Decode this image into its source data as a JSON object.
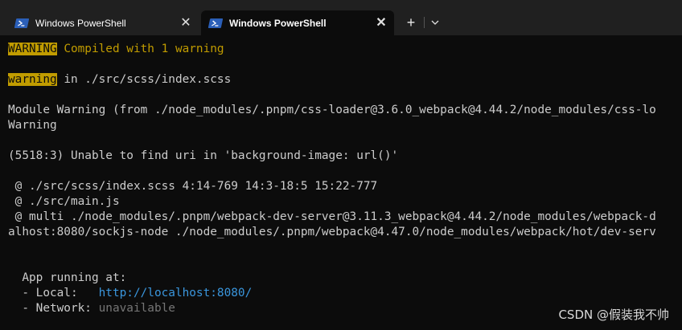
{
  "tabs": [
    {
      "label": "Windows PowerShell",
      "active": false
    },
    {
      "label": "Windows PowerShell",
      "active": true
    }
  ],
  "tab_controls": {
    "close_glyph": "✕",
    "new_tab_glyph": "+",
    "dropdown_glyph": "chevron-down-icon"
  },
  "terminal": {
    "line1": {
      "badge": "WARNING",
      "text": " Compiled with 1 warning"
    },
    "line2": {
      "badge": "warning",
      "text": " in ./src/scss/index.scss"
    },
    "line3": "Module Warning (from ./node_modules/.pnpm/css-loader@3.6.0_webpack@4.44.2/node_modules/css-lo",
    "line4": "Warning",
    "line5": "(5518:3) Unable to find uri in 'background-image: url()'",
    "line6": " @ ./src/scss/index.scss 4:14-769 14:3-18:5 15:22-777",
    "line7": " @ ./src/main.js",
    "line8": " @ multi ./node_modules/.pnpm/webpack-dev-server@3.11.3_webpack@4.44.2/node_modules/webpack-d",
    "line9": "alhost:8080/sockjs-node ./node_modules/.pnpm/webpack@4.47.0/node_modules/webpack/hot/dev-serv",
    "app_running": "  App running at:",
    "local_label": "  - Local:   ",
    "local_url": "http://localhost:8080/",
    "network_label": "  - Network: ",
    "network_value": "unavailable"
  },
  "colors": {
    "background": "#0c0c0c",
    "tabstrip": "#202020",
    "warning_yellow": "#c19c00",
    "link_cyan": "#3a96dd",
    "muted_grey": "#767676",
    "text": "#cccccc"
  },
  "watermark": "CSDN @假装我不帅"
}
